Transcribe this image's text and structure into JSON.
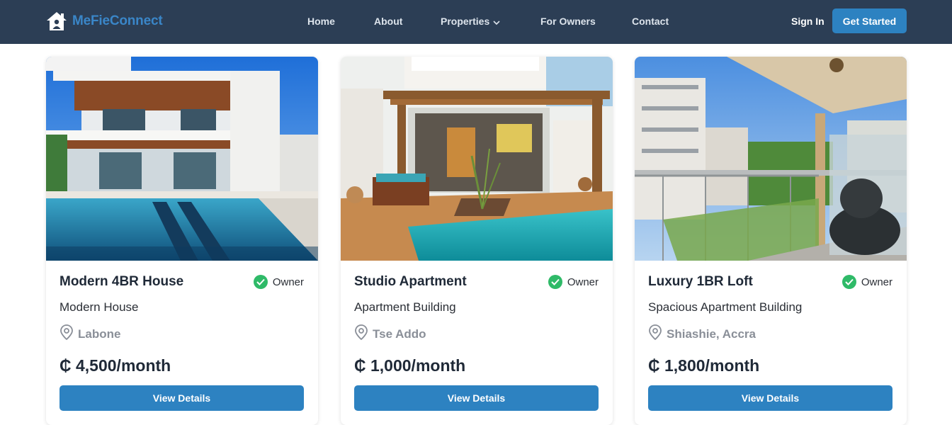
{
  "nav": {
    "brand": "MeFieConnect",
    "brand_icon": "house-icon",
    "links": [
      "Home",
      "About",
      "Properties",
      "For Owners",
      "Contact"
    ],
    "properties_dropdown_icon": "chevron-down-icon",
    "sign_in": "Sign In",
    "get_started": "Get Started"
  },
  "colors": {
    "nav_bg": "#2c3e55",
    "accent": "#2d82c1",
    "owner_badge": "#2fba68"
  },
  "listings": [
    {
      "title": "Modern 4BR House",
      "badge": "Owner",
      "type": "Modern House",
      "location": "Labone",
      "price": "₵ 4,500/month",
      "button": "View Details"
    },
    {
      "title": "Studio Apartment",
      "badge": "Owner",
      "type": "Apartment Building",
      "location": "Tse Addo",
      "price": "₵ 1,000/month",
      "button": "View Details"
    },
    {
      "title": "Luxury 1BR Loft",
      "badge": "Owner",
      "type": "Spacious Apartment Building",
      "location": "Shiashie, Accra",
      "price": "₵ 1,800/month",
      "button": "View Details"
    }
  ]
}
